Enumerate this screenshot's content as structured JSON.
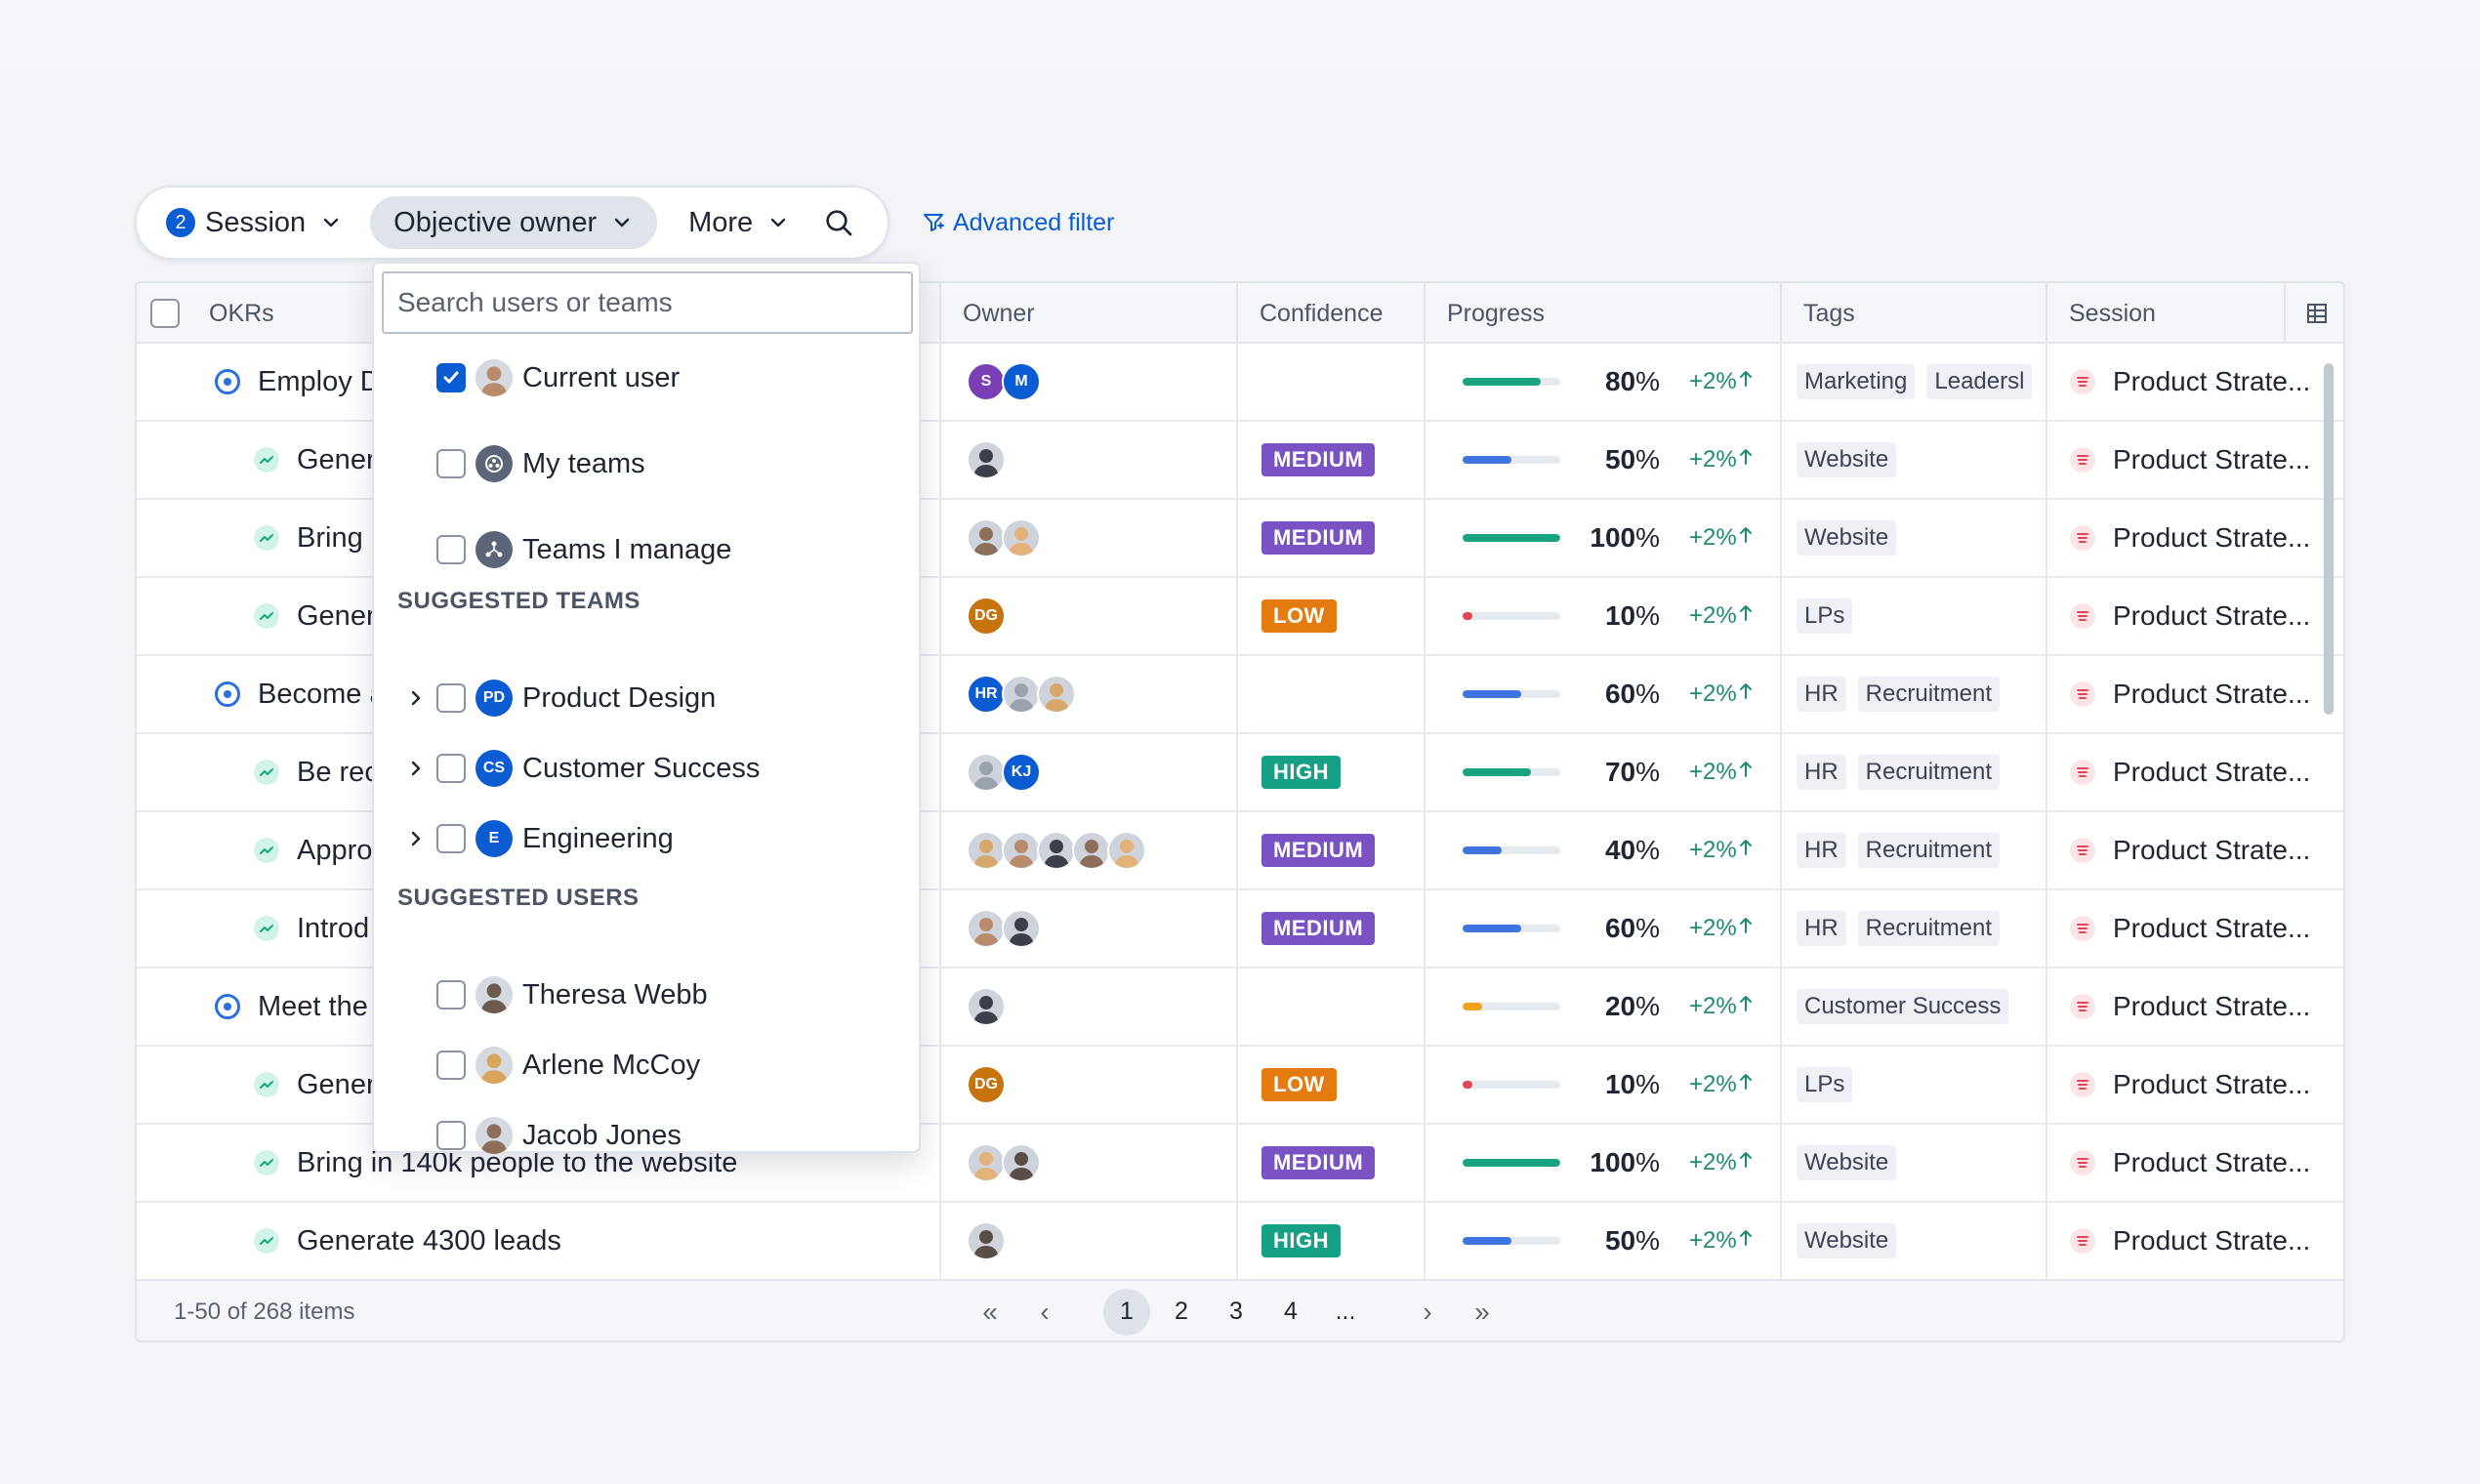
{
  "filters": {
    "session_label": "Session",
    "session_count": "2",
    "objective_owner_label": "Objective owner",
    "more_label": "More",
    "advanced_filter_label": "Advanced filter"
  },
  "table": {
    "columns": [
      "OKRs",
      "Owner",
      "Confidence",
      "Progress",
      "Tags",
      "Session"
    ],
    "rows": [
      {
        "type": "objective",
        "name": "Employ D",
        "owners": [
          "S",
          "M"
        ],
        "confidence": "",
        "progress": "80",
        "delta": "+2%",
        "tags": [
          "Marketing",
          "Leadersl"
        ],
        "session": "Product Strate..."
      },
      {
        "type": "kr",
        "name": "Gener",
        "owners": [
          "photo"
        ],
        "confidence": "MEDIUM",
        "progress": "50",
        "delta": "+2%",
        "tags": [
          "Website"
        ],
        "session": "Product Strate..."
      },
      {
        "type": "kr",
        "name": "Bring i",
        "owners": [
          "photo",
          "photo"
        ],
        "confidence": "MEDIUM",
        "progress": "100",
        "delta": "+2%",
        "tags": [
          "Website"
        ],
        "session": "Product Strate..."
      },
      {
        "type": "kr",
        "name": "Gener",
        "owners": [
          "DG"
        ],
        "confidence": "LOW",
        "progress": "10",
        "delta": "+2%",
        "tags": [
          "LPs"
        ],
        "session": "Product Strate..."
      },
      {
        "type": "objective",
        "name": "Become a",
        "owners": [
          "HR",
          "photo",
          "photo"
        ],
        "confidence": "",
        "progress": "60",
        "delta": "+2%",
        "tags": [
          "HR",
          "Recruitment"
        ],
        "session": "Product Strate..."
      },
      {
        "type": "kr",
        "name": "Be rec",
        "owners": [
          "photo",
          "KJ"
        ],
        "confidence": "HIGH",
        "progress": "70",
        "delta": "+2%",
        "tags": [
          "HR",
          "Recruitment"
        ],
        "session": "Product Strate..."
      },
      {
        "type": "kr",
        "name": "Appro",
        "owners": [
          "photo",
          "photo",
          "photo",
          "photo",
          "photo"
        ],
        "confidence": "MEDIUM",
        "progress": "40",
        "delta": "+2%",
        "tags": [
          "HR",
          "Recruitment"
        ],
        "session": "Product Strate..."
      },
      {
        "type": "kr",
        "name": "Introd",
        "owners": [
          "photo",
          "photo"
        ],
        "confidence": "MEDIUM",
        "progress": "60",
        "delta": "+2%",
        "tags": [
          "HR",
          "Recruitment"
        ],
        "session": "Product Strate..."
      },
      {
        "type": "objective",
        "name": "Meet the",
        "owners": [
          "photo"
        ],
        "confidence": "",
        "progress": "20",
        "delta": "+2%",
        "tags": [
          "Customer Success"
        ],
        "session": "Product Strate..."
      },
      {
        "type": "kr",
        "name": "Gener",
        "owners": [
          "DG"
        ],
        "confidence": "LOW",
        "progress": "10",
        "delta": "+2%",
        "tags": [
          "LPs"
        ],
        "session": "Product Strate..."
      },
      {
        "type": "kr",
        "name": "Bring in 140k people to the website",
        "owners": [
          "photo",
          "photo"
        ],
        "confidence": "MEDIUM",
        "progress": "100",
        "delta": "+2%",
        "tags": [
          "Website"
        ],
        "session": "Product Strate..."
      },
      {
        "type": "kr",
        "name": "Generate 4300 leads",
        "owners": [
          "photo"
        ],
        "confidence": "HIGH",
        "progress": "50",
        "delta": "+2%",
        "tags": [
          "Website"
        ],
        "session": "Product Strate..."
      }
    ],
    "footer": {
      "items_label": "1-50 of 268 items",
      "pages": [
        "1",
        "2",
        "3",
        "4",
        "..."
      ],
      "current_page": "1"
    }
  },
  "dropdown": {
    "search_placeholder": "Search users or teams",
    "top_options": [
      {
        "label": "Current user",
        "checked": true,
        "icon": "user-photo-icon"
      },
      {
        "label": "My teams",
        "checked": false,
        "icon": "team-icon"
      },
      {
        "label": "Teams I manage",
        "checked": false,
        "icon": "org-icon"
      }
    ],
    "suggested_teams_heading": "SUGGESTED TEAMS",
    "suggested_teams": [
      {
        "label": "Product Design",
        "initials": "PD"
      },
      {
        "label": "Customer Success",
        "initials": "CS"
      },
      {
        "label": "Engineering",
        "initials": "E"
      }
    ],
    "suggested_users_heading": "SUGGESTED USERS",
    "suggested_users": [
      {
        "label": "Theresa Webb"
      },
      {
        "label": "Arlene McCoy"
      },
      {
        "label": "Jacob Jones"
      }
    ]
  },
  "colors": {
    "primary": "#0b5bd3",
    "progress_green": "#1aa383",
    "progress_blue": "#3f73e0",
    "progress_red": "#e0455a",
    "progress_yellow": "#f0a31c"
  }
}
